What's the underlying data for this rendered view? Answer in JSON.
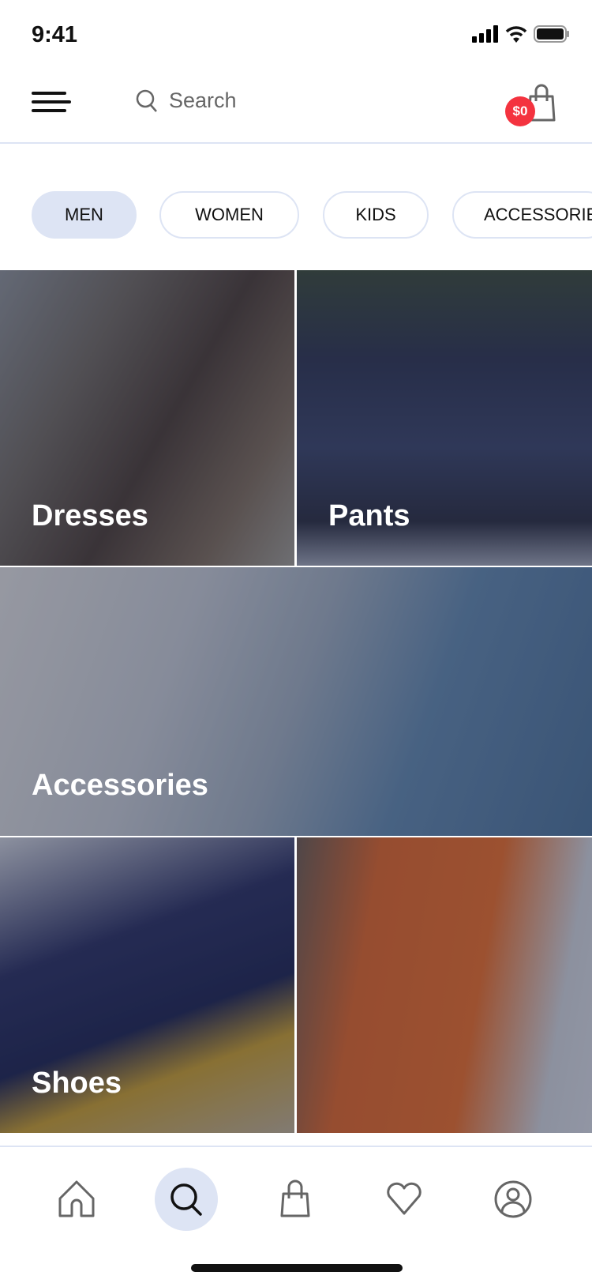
{
  "status_bar": {
    "time": "9:41"
  },
  "header": {
    "search_placeholder": "Search",
    "cart_badge": "$0"
  },
  "chips": [
    {
      "label": "MEN",
      "active": true
    },
    {
      "label": "WOMEN",
      "active": false
    },
    {
      "label": "KIDS",
      "active": false
    },
    {
      "label": "ACCESSORIES",
      "active": false
    }
  ],
  "categories": [
    {
      "label": "Dresses"
    },
    {
      "label": "Pants"
    },
    {
      "label": "Accessories"
    },
    {
      "label": "Shoes"
    },
    {
      "label": ""
    }
  ],
  "bottom_nav": [
    {
      "icon": "home-icon",
      "active": false
    },
    {
      "icon": "search-icon",
      "active": true
    },
    {
      "icon": "bag-icon",
      "active": false
    },
    {
      "icon": "heart-icon",
      "active": false
    },
    {
      "icon": "profile-icon",
      "active": false
    }
  ],
  "colors": {
    "accent": "#dde4f4",
    "badge": "#f4333f"
  }
}
